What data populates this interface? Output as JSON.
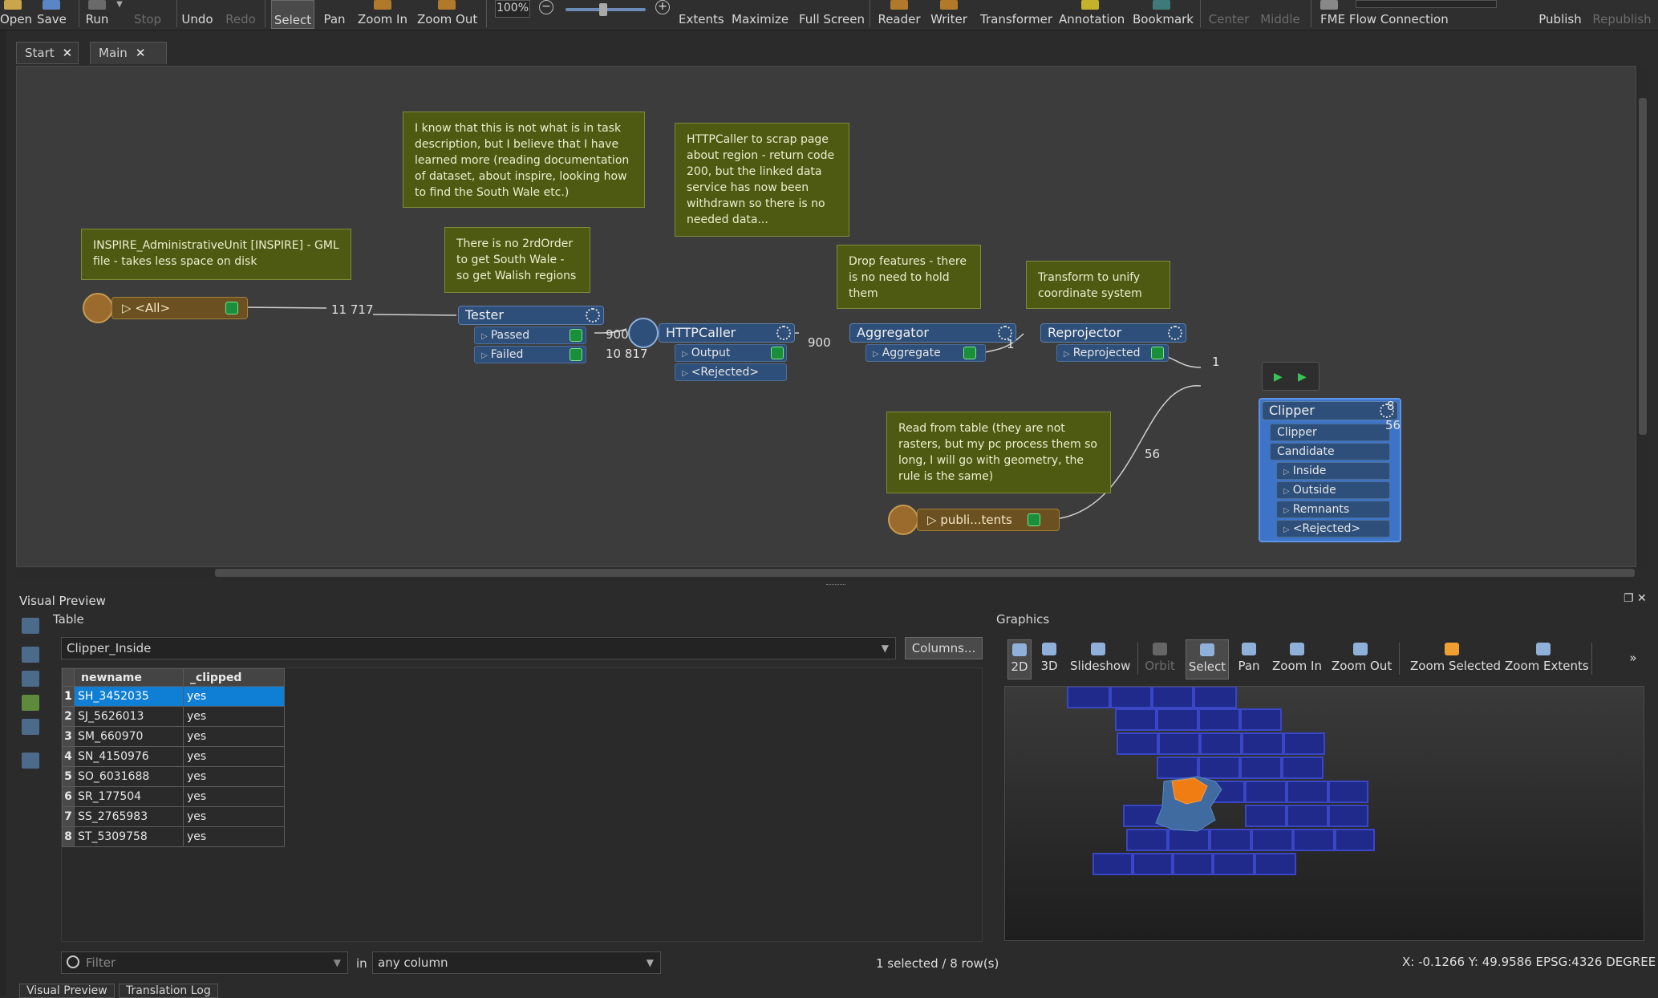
{
  "toolbar": {
    "items": [
      {
        "label": "Open",
        "state": "normal"
      },
      {
        "label": "Save",
        "state": "normal"
      },
      {
        "label": "Run",
        "state": "normal"
      },
      {
        "label": "Stop",
        "state": "disabled"
      },
      {
        "label": "Undo",
        "state": "normal"
      },
      {
        "label": "Redo",
        "state": "disabled"
      },
      {
        "label": "Select",
        "state": "active"
      },
      {
        "label": "Pan",
        "state": "normal"
      },
      {
        "label": "Zoom In",
        "state": "normal"
      },
      {
        "label": "Zoom Out",
        "state": "normal"
      },
      {
        "label": "Extents",
        "state": "normal"
      },
      {
        "label": "Maximize",
        "state": "normal"
      },
      {
        "label": "Full Screen",
        "state": "normal"
      },
      {
        "label": "Reader",
        "state": "normal"
      },
      {
        "label": "Writer",
        "state": "normal"
      },
      {
        "label": "Transformer",
        "state": "normal"
      },
      {
        "label": "Annotation",
        "state": "normal"
      },
      {
        "label": "Bookmark",
        "state": "normal"
      },
      {
        "label": "Center",
        "state": "disabled"
      },
      {
        "label": "Middle",
        "state": "disabled"
      },
      {
        "label": "FME Flow Connection",
        "state": "normal"
      },
      {
        "label": "Publish",
        "state": "normal"
      },
      {
        "label": "Republish",
        "state": "disabled"
      }
    ],
    "zoom_value": "100%"
  },
  "tabs": [
    {
      "label": "Start"
    },
    {
      "label": "Main"
    }
  ],
  "canvas": {
    "notes": {
      "reader_note": "INSPIRE_AdministrativeUnit [INSPIRE] - GML file - takes less space on disk",
      "task_note": "I know that this is not what is in task description, but I believe that I have learned more (reading documentation of dataset, about inspire, looking how to find the South Wale etc.)",
      "tester_note": "There is no 2rdOrder to get South Wale - so get Walish regions",
      "http_note": "HTTPCaller to scrap page about region - return code 200, but the linked data service has now been withdrawn so there is no needed data...",
      "aggregator_note": "Drop features - there is no need to hold them",
      "reprojector_note": "Transform to unify coordinate system",
      "table_note": "Read from table (they are not rasters, but my pc process them so long, I will go with geometry, the rule is the same)"
    },
    "reader1": {
      "label": "<All>"
    },
    "reader2": {
      "label": "publi...tents"
    },
    "tester": {
      "label": "Tester",
      "ports": [
        "Passed",
        "Failed"
      ]
    },
    "httpcaller": {
      "label": "HTTPCaller",
      "ports": [
        "Output",
        "<Rejected>"
      ]
    },
    "aggregator": {
      "label": "Aggregator",
      "ports": [
        "Aggregate"
      ]
    },
    "reprojector": {
      "label": "Reprojector",
      "ports": [
        "Reprojected"
      ]
    },
    "clipper": {
      "label": "Clipper",
      "inputs": [
        "Clipper",
        "Candidate"
      ],
      "outputs": [
        "Inside",
        "Outside",
        "Remnants",
        "<Rejected>"
      ]
    },
    "counts": {
      "reader_to_tester": "11 717",
      "passed": "900",
      "failed": "10 817",
      "http_output": "900",
      "aggregate": "1",
      "reprojected": "1",
      "table_reader": "56",
      "inside": "8",
      "outside": "56"
    }
  },
  "visual_preview": {
    "title": "Visual Preview",
    "table_label": "Table",
    "selected_table": "Clipper_Inside",
    "columns_button": "Columns...",
    "headers": [
      "newname",
      "_clipped"
    ],
    "rows": [
      {
        "n": "1",
        "newname": "SH_3452035",
        "clipped": "yes"
      },
      {
        "n": "2",
        "newname": "SJ_5626013",
        "clipped": "yes"
      },
      {
        "n": "3",
        "newname": "SM_660970",
        "clipped": "yes"
      },
      {
        "n": "4",
        "newname": "SN_4150976",
        "clipped": "yes"
      },
      {
        "n": "5",
        "newname": "SO_6031688",
        "clipped": "yes"
      },
      {
        "n": "6",
        "newname": "SR_177504",
        "clipped": "yes"
      },
      {
        "n": "7",
        "newname": "SS_2765983",
        "clipped": "yes"
      },
      {
        "n": "8",
        "newname": "ST_5309758",
        "clipped": "yes"
      }
    ],
    "filter_placeholder": "Filter",
    "in_label": "in",
    "column_option": "any column",
    "status": "1 selected / 8 row(s)"
  },
  "graphics": {
    "title": "Graphics",
    "buttons": [
      {
        "label": "2D",
        "state": "active"
      },
      {
        "label": "3D",
        "state": "normal"
      },
      {
        "label": "Slideshow",
        "state": "normal"
      },
      {
        "label": "Orbit",
        "state": "disabled"
      },
      {
        "label": "Select",
        "state": "active"
      },
      {
        "label": "Pan",
        "state": "normal"
      },
      {
        "label": "Zoom In",
        "state": "normal"
      },
      {
        "label": "Zoom Out",
        "state": "normal"
      },
      {
        "label": "Zoom Selected",
        "state": "normal"
      },
      {
        "label": "Zoom Extents",
        "state": "normal"
      }
    ],
    "more": "»",
    "coords": "X:  -0.1266  Y:  49.9586  EPSG:4326  DEGREE"
  },
  "bottom_tabs": [
    "Visual Preview",
    "Translation Log"
  ],
  "colors": {
    "transformer": "#2e4f7a",
    "reader": "#6b5021",
    "note": "#4e5a12",
    "selection": "#0f7fd6",
    "grid_tile": "#1f2a8a",
    "highlight": "#f07d13"
  }
}
